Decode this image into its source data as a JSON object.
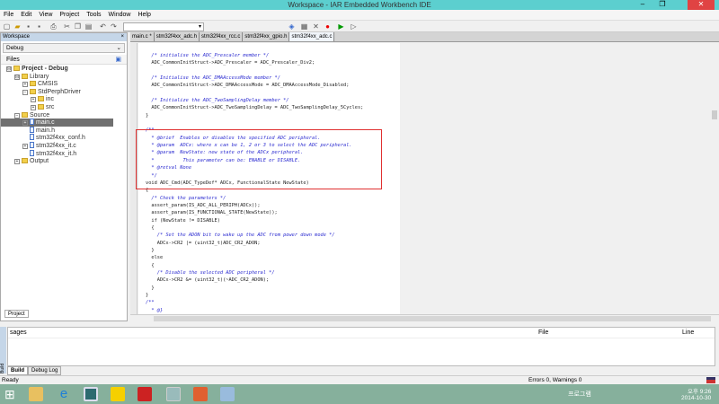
{
  "window": {
    "title": "Workspace - IAR Embedded Workbench IDE",
    "minimize": "–",
    "restore": "❐",
    "close": "✕"
  },
  "menu": [
    "File",
    "Edit",
    "View",
    "Project",
    "Tools",
    "Window",
    "Help"
  ],
  "workspace": {
    "header": "Workspace",
    "config": "Debug",
    "files_label": "Files",
    "tab": "Project",
    "tree": [
      {
        "label": "Project - Debug",
        "depth": 0,
        "type": "project",
        "exp": "⊟"
      },
      {
        "label": "Library",
        "depth": 1,
        "type": "folder",
        "exp": "⊟"
      },
      {
        "label": "CMSIS",
        "depth": 2,
        "type": "folder",
        "exp": "+"
      },
      {
        "label": "StdPerphDriver",
        "depth": 2,
        "type": "folder",
        "exp": "−"
      },
      {
        "label": "inc",
        "depth": 3,
        "type": "folder",
        "exp": "+"
      },
      {
        "label": "src",
        "depth": 3,
        "type": "folder",
        "exp": "+"
      },
      {
        "label": "Source",
        "depth": 1,
        "type": "folder",
        "exp": "−"
      },
      {
        "label": "main.c",
        "depth": 2,
        "type": "file",
        "exp": "+",
        "selected": true
      },
      {
        "label": "main.h",
        "depth": 2,
        "type": "file"
      },
      {
        "label": "stm32f4xx_conf.h",
        "depth": 2,
        "type": "file"
      },
      {
        "label": "stm32f4xx_it.c",
        "depth": 2,
        "type": "file",
        "exp": "+"
      },
      {
        "label": "stm32f4xx_it.h",
        "depth": 2,
        "type": "file"
      },
      {
        "label": "Output",
        "depth": 1,
        "type": "folder",
        "exp": "+"
      }
    ]
  },
  "editor": {
    "tabs": [
      "main.c *",
      "stm32f4xx_adc.h",
      "stm32f4xx_rcc.c",
      "stm32f4xx_gpio.h",
      "stm32f4xx_adc.c"
    ],
    "active_tab": 4,
    "lines": [
      {
        "t": "  /* initialise the ADC_Prescaler member */",
        "c": 1
      },
      {
        "t": "  ADC_CommonInitStruct->ADC_Prescaler = ADC_Prescaler_Div2;"
      },
      {
        "t": ""
      },
      {
        "t": "  /* Initialise the ADC_DMAAccessMode member */",
        "c": 1
      },
      {
        "t": "  ADC_CommonInitStruct->ADC_DMAAccessMode = ADC_DMAAccessMode_Disabled;"
      },
      {
        "t": ""
      },
      {
        "t": "  /* Initialize the ADC_TwoSamplingDelay member */",
        "c": 1
      },
      {
        "t": "  ADC_CommonInitStruct->ADC_TwoSamplingDelay = ADC_TwoSamplingDelay_5Cycles;"
      },
      {
        "t": "}"
      },
      {
        "t": ""
      },
      {
        "t": "/**",
        "c": 1
      },
      {
        "t": "  * @brief  Enables or disables the specified ADC peripheral.",
        "c": 1
      },
      {
        "t": "  * @param  ADCx: where x can be 1, 2 or 3 to select the ADC peripheral.",
        "c": 1
      },
      {
        "t": "  * @param  NewState: new state of the ADCx peripheral.",
        "c": 1
      },
      {
        "t": "  *          This parameter can be: ENABLE or DISABLE.",
        "c": 1
      },
      {
        "t": "  * @retval None",
        "c": 1
      },
      {
        "t": "  */",
        "c": 1
      },
      {
        "t": "void ADC_Cmd(ADC_TypeDef* ADCx, FunctionalState NewState)"
      },
      {
        "t": "{"
      },
      {
        "t": "  /* Check the parameters */",
        "c": 1
      },
      {
        "t": "  assert_param(IS_ADC_ALL_PERIPH(ADCx));"
      },
      {
        "t": "  assert_param(IS_FUNCTIONAL_STATE(NewState));"
      },
      {
        "t": "  if (NewState != DISABLE)"
      },
      {
        "t": "  {"
      },
      {
        "t": "    /* Set the ADON bit to wake up the ADC from power down mode */",
        "c": 1
      },
      {
        "t": "    ADCx->CR2 |= (uint32_t)ADC_CR2_ADON;"
      },
      {
        "t": "  }"
      },
      {
        "t": "  else"
      },
      {
        "t": "  {"
      },
      {
        "t": "    /* Disable the selected ADC peripheral */",
        "c": 1
      },
      {
        "t": "    ADCx->CR2 &= (uint32_t)(~ADC_CR2_ADON);"
      },
      {
        "t": "  }"
      },
      {
        "t": "}"
      },
      {
        "t": "/**",
        "c": 1
      },
      {
        "t": "  * @}",
        "c": 1
      }
    ]
  },
  "messages": {
    "col_messages": "sages",
    "col_file": "File",
    "col_line": "Line",
    "side_tab": "Build",
    "tabs": [
      "Build",
      "Debug Log"
    ]
  },
  "status": {
    "left": "Ready",
    "errors": "Errors 0, Warnings 0"
  },
  "taskbar": {
    "tray_text": "프로그램",
    "time": "오후 9:26",
    "date": "2014-10-30"
  },
  "colors": {
    "title": "#5ccfcf",
    "selection_box": "#e03030",
    "comment": "#2a2ad0",
    "taskbar": "#86b09c"
  }
}
